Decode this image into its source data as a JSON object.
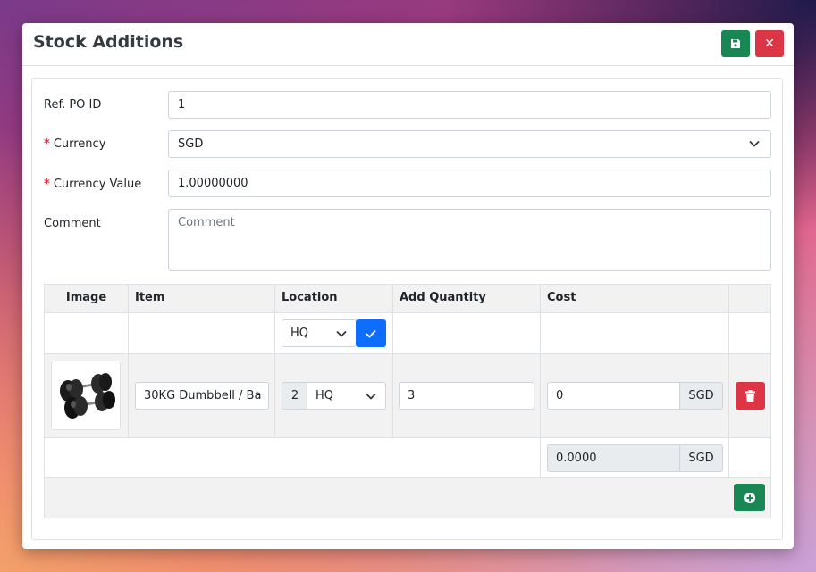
{
  "modal": {
    "title": "Stock Additions",
    "save_icon": "floppy-disk-icon",
    "close_icon": "close-icon",
    "accent_success": "#198754",
    "accent_danger": "#dc3545",
    "accent_primary": "#0d6efd"
  },
  "form": {
    "ref_po": {
      "label": "Ref. PO ID",
      "value": "1"
    },
    "currency": {
      "label": "Currency",
      "value": "SGD",
      "required_mark": "*"
    },
    "currency_value": {
      "label": "Currency Value",
      "value": "1.00000000",
      "required_mark": "*"
    },
    "comment": {
      "label": "Comment",
      "placeholder": "Comment",
      "value": ""
    }
  },
  "table": {
    "headers": [
      "Image",
      "Item",
      "Location",
      "Add Quantity",
      "Cost",
      ""
    ],
    "bulk_location": {
      "value": "HQ",
      "apply_icon": "check-icon"
    },
    "rows": [
      {
        "image_alt": "dumbbell-product-image",
        "item": "30KG Dumbbell / Ba",
        "location_count": "2",
        "location": "HQ",
        "quantity": "3",
        "cost": "0",
        "currency": "SGD",
        "delete_icon": "trash-icon"
      }
    ],
    "total": {
      "value": "0.0000",
      "currency": "SGD"
    },
    "add_icon": "plus-circle-icon"
  }
}
